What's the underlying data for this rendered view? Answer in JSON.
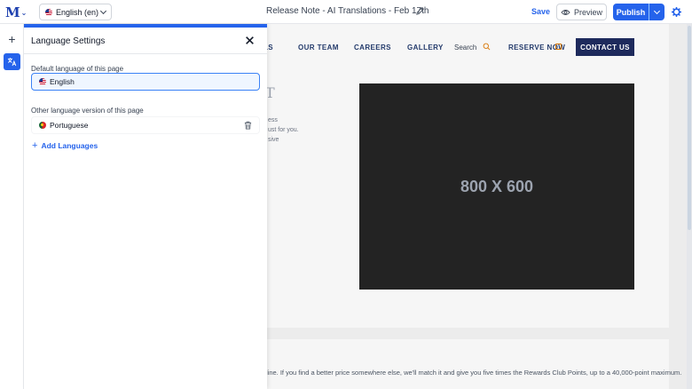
{
  "topbar": {
    "logo_letter": "M",
    "language_selector": {
      "value": "English (en)"
    },
    "page_title": "Release Note - AI Translations - Feb 17th",
    "save_label": "Save",
    "preview_label": "Preview",
    "publish_label": "Publish"
  },
  "icons": {
    "logo": "logo-icon",
    "edit": "pencil-icon",
    "preview": "eye-icon",
    "settings": "gear-icon",
    "add": "plus-icon",
    "translate": "translate-icon",
    "close": "close-icon",
    "delete": "trash-icon",
    "search": "search-icon",
    "calendar": "calendar-icon"
  },
  "colors": {
    "accent": "#2563eb",
    "contact_button": "#1e2a5c",
    "placeholder_bg": "#232323"
  },
  "panel": {
    "title": "Language Settings",
    "default_label": "Default language of this page",
    "default_value": "English",
    "other_label": "Other language version of this page",
    "other_languages": [
      "Portuguese"
    ],
    "add_label": "Add Languages"
  },
  "site": {
    "nav": {
      "partial_item": "LS",
      "our_team": "OUR TEAM",
      "careers": "CAREERS",
      "gallery": "GALLERY",
      "search": "Search",
      "reserve_now": "RESERVE NOW",
      "contact_us": "CONTACT US"
    },
    "hero": {
      "heading_fragment": "T",
      "lines": [
        "ess",
        "ust for you.",
        "sive"
      ]
    },
    "placeholder_text": "800 X 600",
    "bottom_text": "line. If you find a better price somewhere else, we'll match it and give you five times the Rewards Club Points, up to a 40,000-point maximum."
  }
}
